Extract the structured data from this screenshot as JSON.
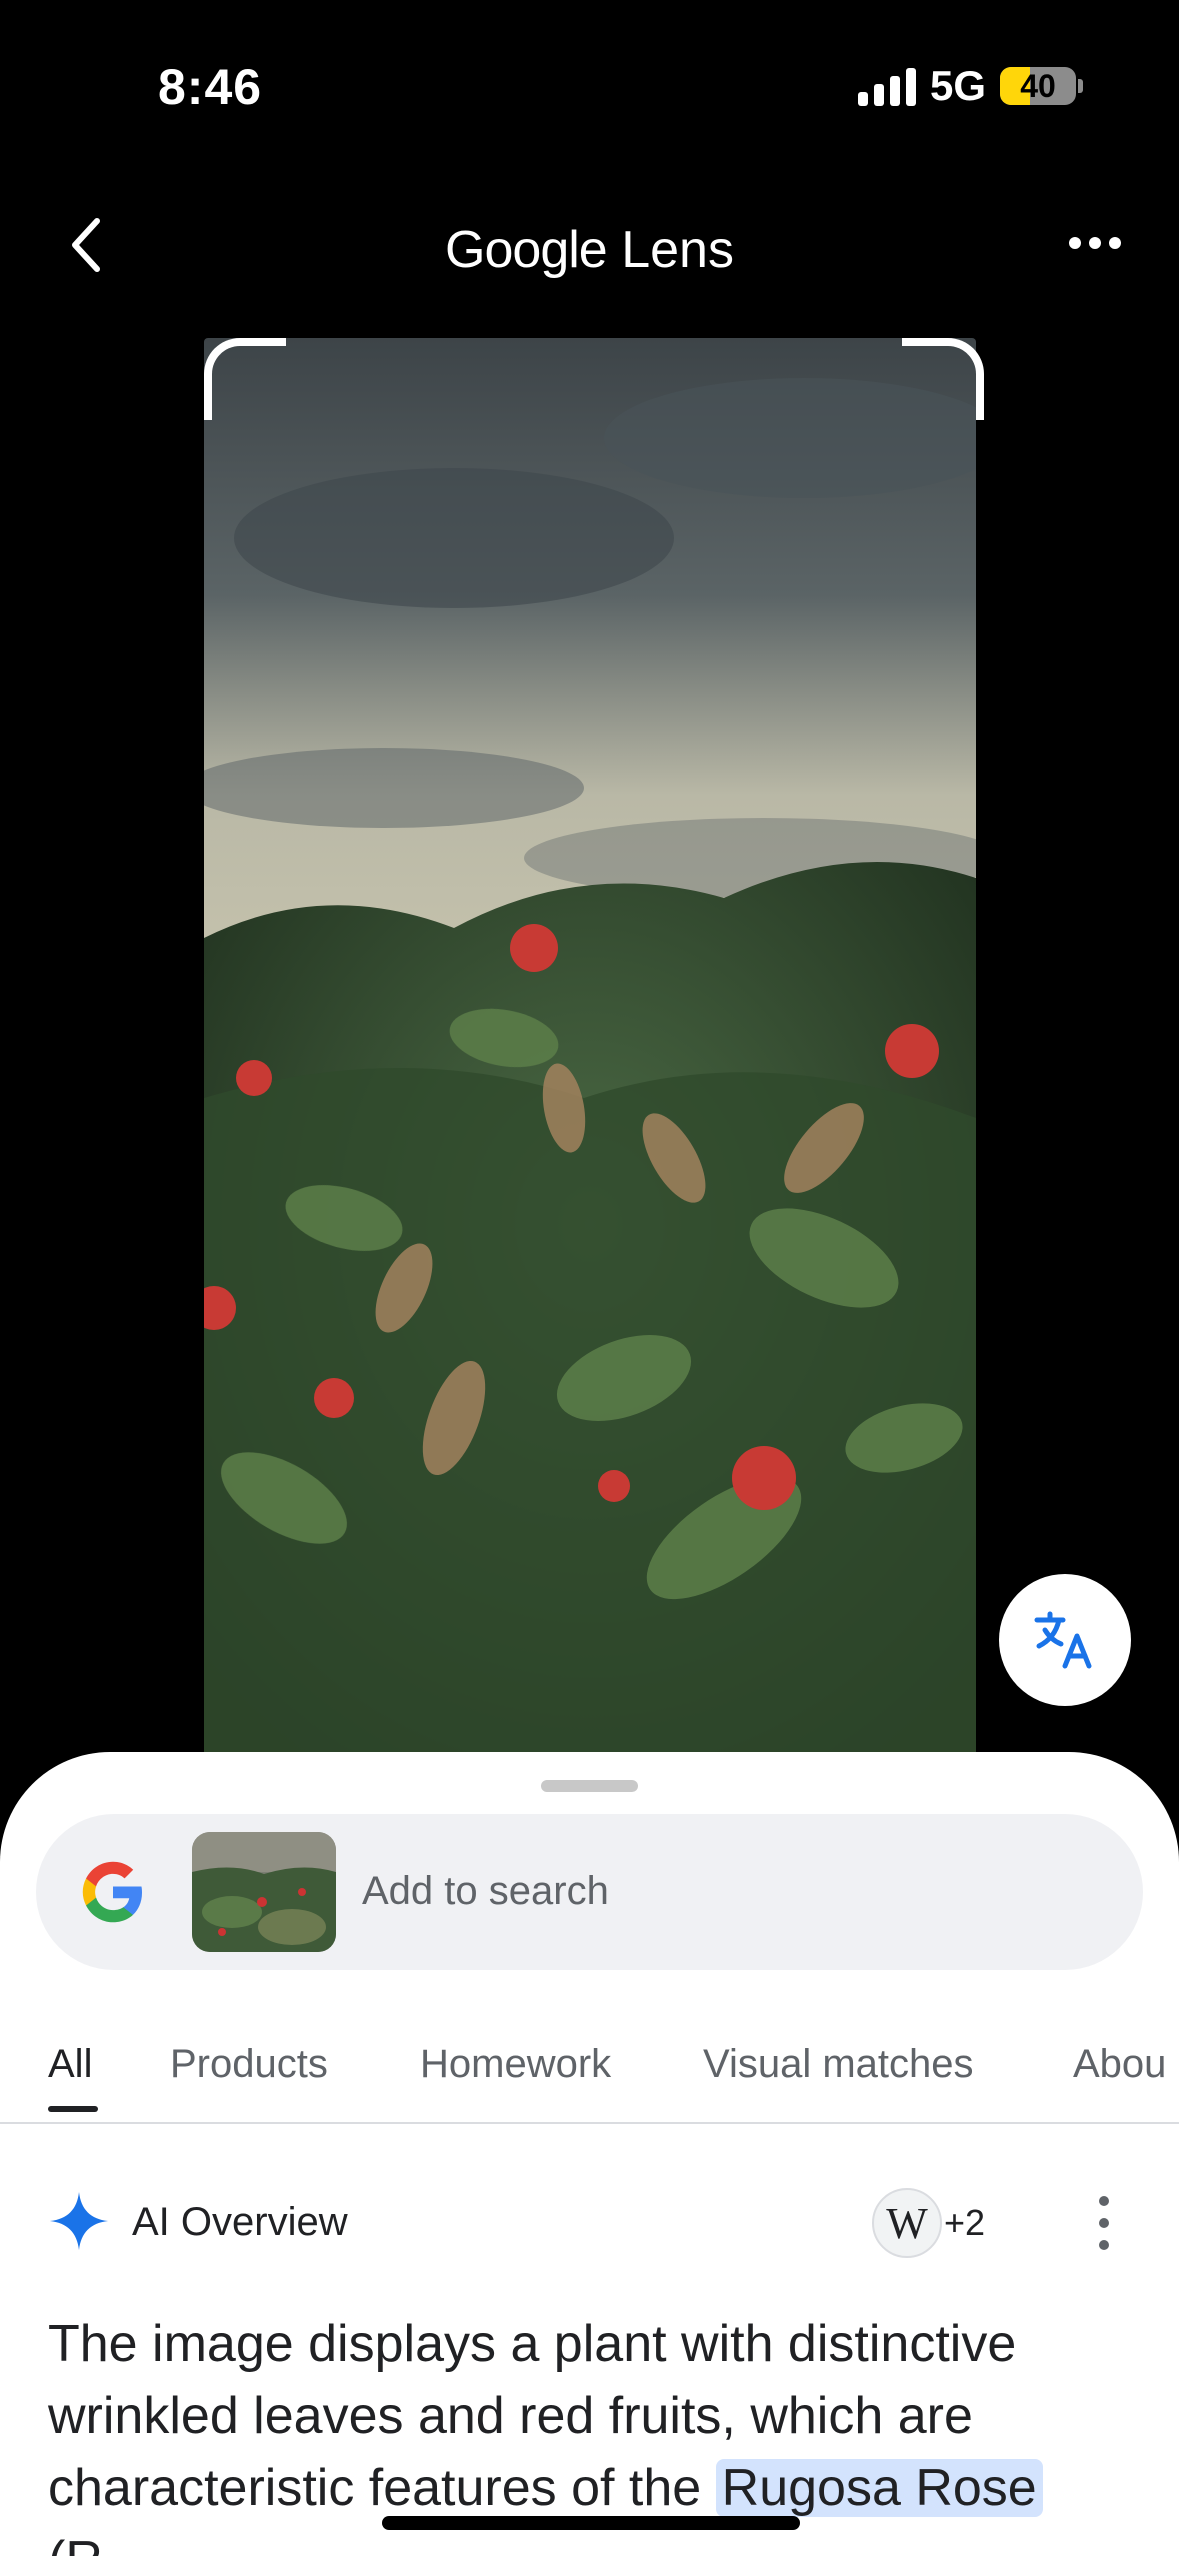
{
  "status_bar": {
    "time": "8:46",
    "network": "5G",
    "battery_level": "40",
    "battery_percent": 40
  },
  "header": {
    "title_google": "Google",
    "title_lens": "Lens"
  },
  "search": {
    "placeholder": "Add to search"
  },
  "tabs": [
    "All",
    "Products",
    "Homework",
    "Visual matches",
    "Abou"
  ],
  "active_tab": "All",
  "ai_overview": {
    "title": "AI Overview",
    "source_badge": "W",
    "source_count": "+2",
    "text_plain": "The image displays a plant with distinctive wrinkled leaves and red fruits, which are characteristic features of the ",
    "text_highlight": "Rugosa Rose",
    "text_tail": "(R"
  },
  "icons": {
    "back": "chevron-left-icon",
    "more": "more-horizontal-icon",
    "translate": "translate-icon",
    "google": "google-g-icon",
    "ai": "sparkle-icon",
    "wikipedia": "wikipedia-icon",
    "menu": "more-vertical-icon"
  },
  "colors": {
    "accent_blue": "#1a73e8",
    "highlight": "#d3e3fd",
    "battery": "#ffd60a"
  }
}
